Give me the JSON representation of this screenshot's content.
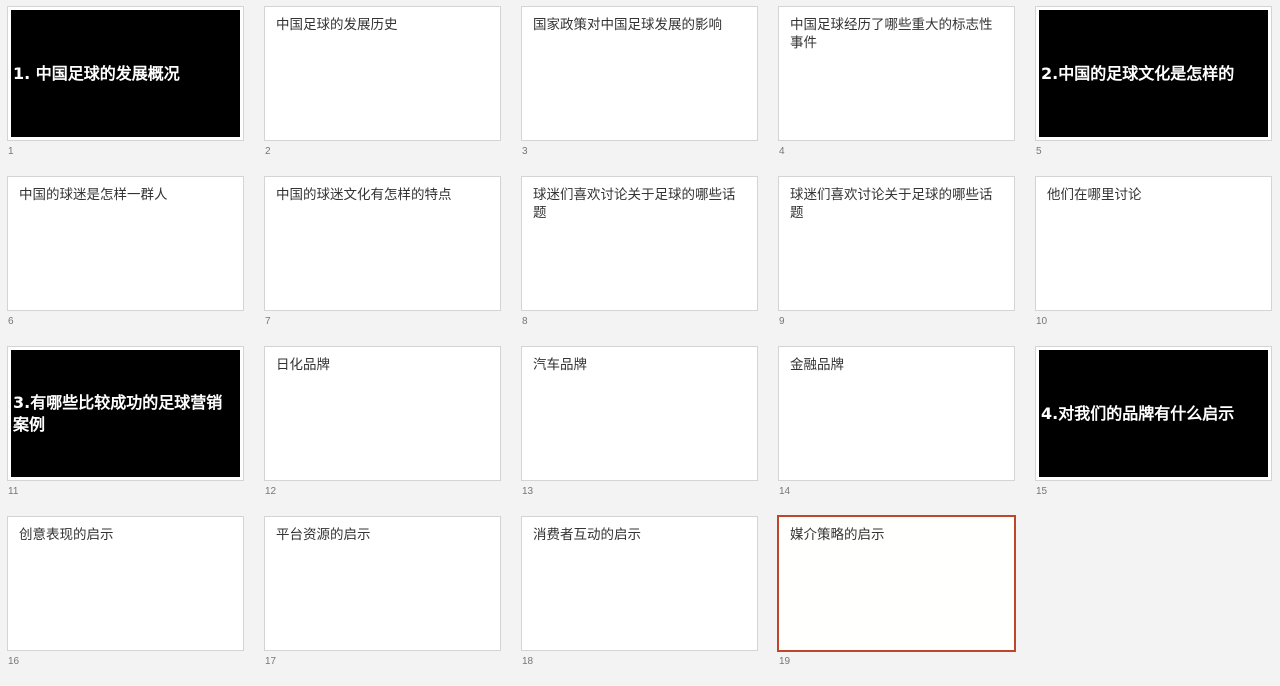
{
  "slides": [
    {
      "number": "1",
      "title": "1. 中国足球的发展概况",
      "dark": true
    },
    {
      "number": "2",
      "title": "中国足球的发展历史",
      "dark": false
    },
    {
      "number": "3",
      "title": "国家政策对中国足球发展的影响",
      "dark": false
    },
    {
      "number": "4",
      "title": "中国足球经历了哪些重大的标志性事件",
      "dark": false
    },
    {
      "number": "5",
      "title": "2.中国的足球文化是怎样的",
      "dark": true
    },
    {
      "number": "6",
      "title": "中国的球迷是怎样一群人",
      "dark": false
    },
    {
      "number": "7",
      "title": "中国的球迷文化有怎样的特点",
      "dark": false
    },
    {
      "number": "8",
      "title": "球迷们喜欢讨论关于足球的哪些话题",
      "dark": false
    },
    {
      "number": "9",
      "title": "球迷们喜欢讨论关于足球的哪些话题",
      "dark": false
    },
    {
      "number": "10",
      "title": "他们在哪里讨论",
      "dark": false
    },
    {
      "number": "11",
      "title": "3.有哪些比较成功的足球营销案例",
      "dark": true
    },
    {
      "number": "12",
      "title": "日化品牌",
      "dark": false
    },
    {
      "number": "13",
      "title": "汽车品牌",
      "dark": false
    },
    {
      "number": "14",
      "title": "金融品牌",
      "dark": false
    },
    {
      "number": "15",
      "title": "4.对我们的品牌有什么启示",
      "dark": true
    },
    {
      "number": "16",
      "title": "创意表现的启示",
      "dark": false
    },
    {
      "number": "17",
      "title": "平台资源的启示",
      "dark": false
    },
    {
      "number": "18",
      "title": "消费者互动的启示",
      "dark": false
    },
    {
      "number": "19",
      "title": "媒介策略的启示",
      "dark": false,
      "selected": true
    }
  ],
  "colors": {
    "background": "#f3f3f3",
    "selection_border": "#c0462a",
    "section_slide": "#000000"
  }
}
